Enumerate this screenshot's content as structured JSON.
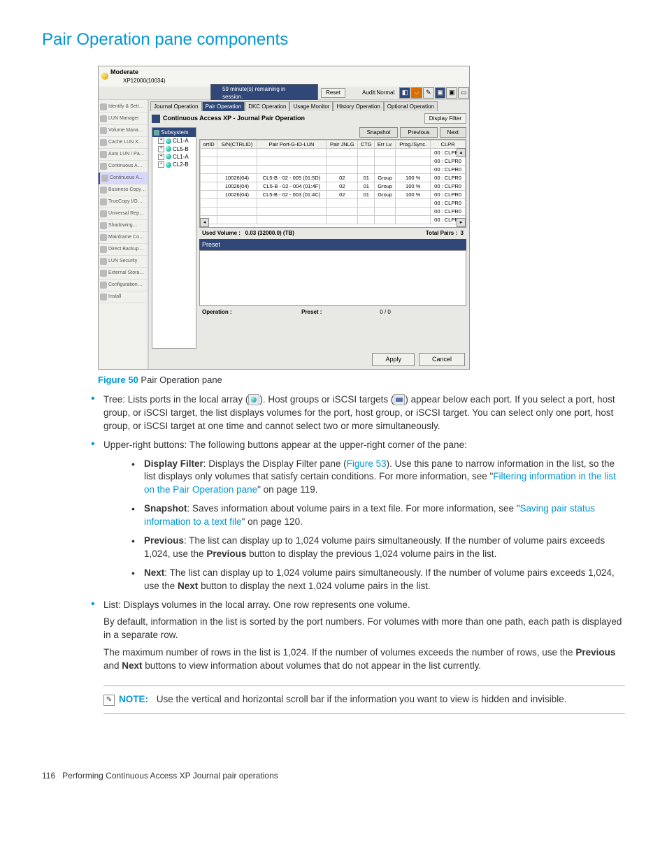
{
  "heading": "Pair Operation pane components",
  "figure": {
    "label": "Figure 50",
    "caption": "Pair Operation pane"
  },
  "screenshot": {
    "title": "Moderate",
    "subtitle": "XP12000(10034)",
    "session": "59 minute(s) remaining in session.",
    "reset": "Reset",
    "audit": "Audit:Normal",
    "sidebar": [
      "Identify & Sett…",
      "LUN Manager",
      "Volume Mana…",
      "Cache LUN X…",
      "Auto LUN / Pa…",
      "Continuous A…",
      "Continuous A…",
      "Business Copy…",
      "TrueCopy I/O…",
      "Universal Rep…",
      "Shadowing…",
      "Mainframe Co…",
      "Direct Backup…",
      "LUN Security",
      "External Stora…",
      "Configuration…",
      "Install"
    ],
    "sidebar_active_index": 6,
    "tabs": [
      "Journal Operation",
      "Pair Operation",
      "DKC Operation",
      "Usage Monitor",
      "History Operation",
      "Optional Operation"
    ],
    "journal_title": "Continuous Access XP - Journal Pair Operation",
    "display_filter": "Display Filter",
    "buttons": {
      "snapshot": "Snapshot",
      "previous": "Previous",
      "next": "Next"
    },
    "tree": {
      "root": "Subsystem",
      "nodes": [
        "CL1-A",
        "CL5-B",
        "CL1-A",
        "CL2-B"
      ]
    },
    "columns": [
      "ortID",
      "S/N(CTRLID)",
      "Pair Port-G-ID-LUN",
      "Pair JNLG",
      "CTG",
      "Err Lv.",
      "Prog./Sync.",
      "CLPR"
    ],
    "rows": [
      [
        "",
        "",
        "",
        "",
        "",
        "",
        "",
        "00 : CLPR0"
      ],
      [
        "",
        "",
        "",
        "",
        "",
        "",
        "",
        "00 : CLPR0"
      ],
      [
        "",
        "",
        "",
        "",
        "",
        "",
        "",
        "00 : CLPR0"
      ],
      [
        "",
        "10026(04)",
        "CL5-B - 02 - 005 (01:5D)",
        "02",
        "01",
        "Group",
        "100 %",
        "00 : CLPR0"
      ],
      [
        "",
        "10026(04)",
        "CL5-B - 02 - 004 (01:4F)",
        "02",
        "01",
        "Group",
        "100 %",
        "00 : CLPR0"
      ],
      [
        "",
        "10026(04)",
        "CL5-B - 02 - 003 (01:4C)",
        "02",
        "01",
        "Group",
        "100 %",
        "00 : CLPR0"
      ],
      [
        "",
        "",
        "",
        "",
        "",
        "",
        "",
        "00 : CLPR0"
      ],
      [
        "",
        "",
        "",
        "",
        "",
        "",
        "",
        "00 : CLPR0"
      ],
      [
        "",
        "",
        "",
        "",
        "",
        "",
        "",
        "00 : CLPR0"
      ]
    ],
    "used_volume_label": "Used Volume :",
    "used_volume_value": "0.03 (32000.0) (TB)",
    "total_pairs_label": "Total Pairs :",
    "total_pairs_value": "3",
    "preset_header": "Preset",
    "operation_label": "Operation :",
    "preset_label": "Preset :",
    "preset_value": "0 / 0",
    "apply": "Apply",
    "cancel": "Cancel"
  },
  "bullets": {
    "tree": {
      "pre": "Tree: Lists ports in the local array (",
      "mid": "). Host groups or iSCSI targets (",
      "post": ") appear below each port. If you select a port, host group, or iSCSI target, the list displays volumes for the port, host group, or iSCSI target. You can select only one port, host group, or iSCSI target at one time and cannot select two or more simultaneously."
    },
    "upper_intro": "Upper-right buttons: The following buttons appear at the upper-right corner of the pane:",
    "display_filter": {
      "label": "Display Filter",
      "text1": ": Displays the Display Filter pane (",
      "link": "Figure 53",
      "text2": "). Use this pane to narrow information in the list, so the list displays only volumes that satisfy certain conditions. For more information, see \"",
      "link2": "Filtering information in the list on the Pair Operation pane",
      "text3": "\" on page 119."
    },
    "snapshot": {
      "label": "Snapshot",
      "text1": ": Saves information about volume pairs in a text file. For more information, see \"",
      "link": "Saving pair status information to a text file",
      "text2": "\" on page 120."
    },
    "previous": {
      "label": "Previous",
      "text": ": The list can display up to 1,024 volume pairs simultaneously. If the number of volume pairs exceeds 1,024, use the ",
      "label2": "Previous",
      "text2": " button to display the previous 1,024 volume pairs in the list."
    },
    "next": {
      "label": "Next",
      "text": ": The list can display up to 1,024 volume pairs simultaneously. If the number of volume pairs exceeds 1,024, use the ",
      "label2": "Next",
      "text2": " button to display the next 1,024 volume pairs in the list."
    },
    "list_line1": "List: Displays volumes in the local array. One row represents one volume.",
    "list_p1": "By default, information in the list is sorted by the port numbers. For volumes with more than one path, each path is displayed in a separate row.",
    "list_p2a": "The maximum number of rows in the list is 1,024. If the number of volumes exceeds the number of rows, use the ",
    "list_p2b": "Previous",
    "list_p2c": " and ",
    "list_p2d": "Next",
    "list_p2e": " buttons to view information about volumes that do not appear in the list currently."
  },
  "note": {
    "label": "NOTE:",
    "text": "Use the vertical and horizontal scroll bar if the information you want to view is hidden and invisible."
  },
  "footer": {
    "page": "116",
    "text": "Performing Continuous Access XP Journal pair operations"
  }
}
